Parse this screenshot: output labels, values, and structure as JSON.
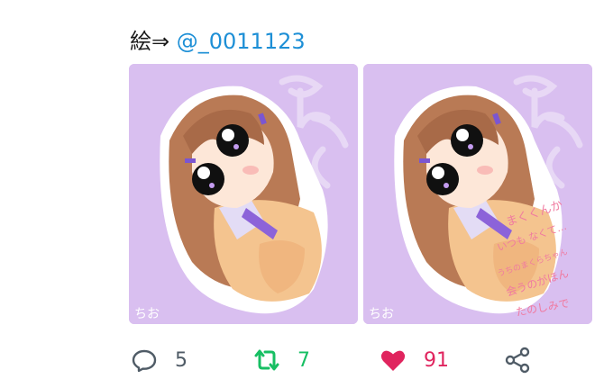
{
  "tweet": {
    "text_prefix": "絵⇒ ",
    "mention": "@_0011123"
  },
  "media": {
    "images": [
      {
        "signature": "ちお"
      },
      {
        "signature": "ちお",
        "handwritten_text": [
          "まくくんか",
          "いつも なくて…",
          "うちのまくらちゃん",
          "会うのがほん",
          "たのしみで"
        ]
      }
    ]
  },
  "actions": {
    "reply": {
      "icon": "reply-icon",
      "count": "5"
    },
    "retweet": {
      "icon": "retweet-icon",
      "count": "7",
      "color": "#17bf63"
    },
    "like": {
      "icon": "heart-icon",
      "count": "91",
      "color": "#e0245e"
    },
    "share": {
      "icon": "share-icon"
    }
  }
}
